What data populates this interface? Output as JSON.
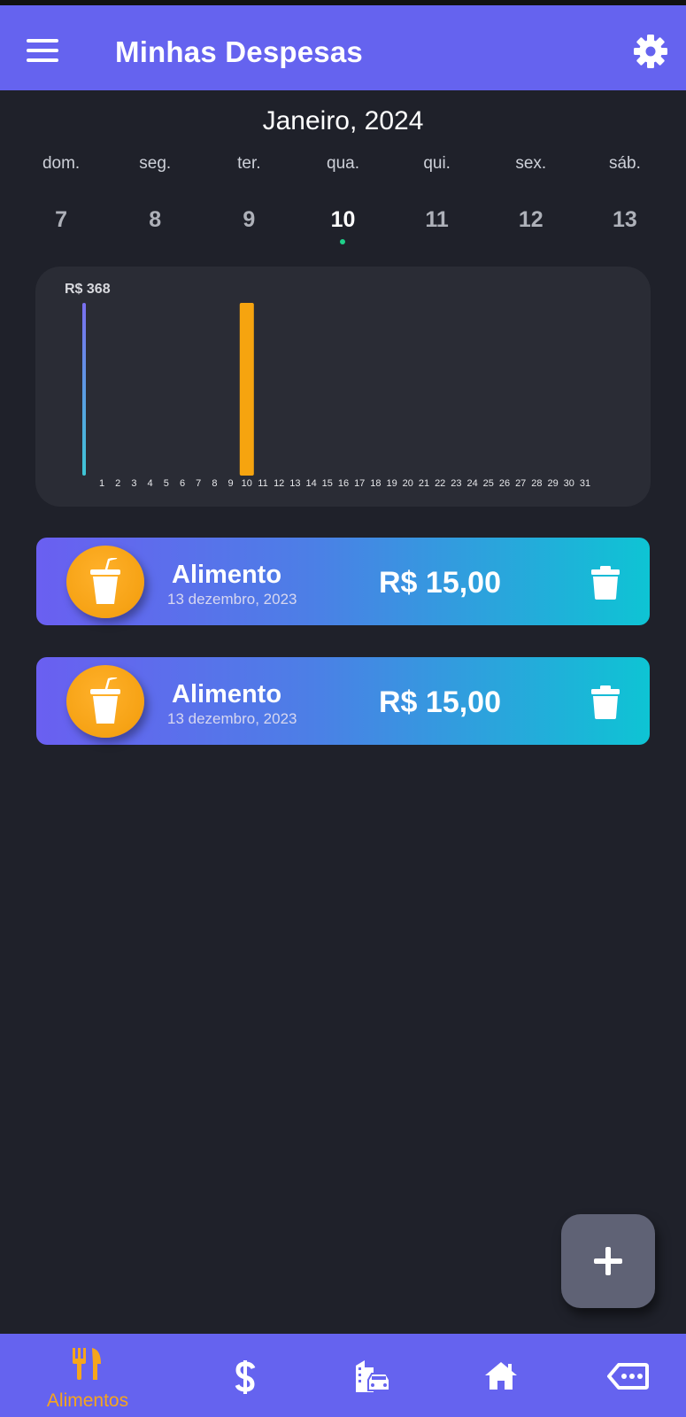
{
  "appbar": {
    "title": "Minhas Despesas"
  },
  "calendar": {
    "month_label": "Janeiro, 2024",
    "weekdays": [
      "dom.",
      "seg.",
      "ter.",
      "qua.",
      "qui.",
      "sex.",
      "sáb."
    ],
    "days": [
      "7",
      "8",
      "9",
      "10",
      "11",
      "12",
      "13"
    ],
    "selected_day": "10"
  },
  "chart_data": {
    "type": "bar",
    "y_max_label": "R$ 368",
    "categories": [
      "1",
      "2",
      "3",
      "4",
      "5",
      "6",
      "7",
      "8",
      "9",
      "10",
      "11",
      "12",
      "13",
      "14",
      "15",
      "16",
      "17",
      "18",
      "19",
      "20",
      "21",
      "22",
      "23",
      "24",
      "25",
      "26",
      "27",
      "28",
      "29",
      "30",
      "31"
    ],
    "values": [
      0,
      0,
      0,
      0,
      0,
      0,
      0,
      0,
      0,
      368,
      0,
      0,
      0,
      0,
      0,
      0,
      0,
      0,
      0,
      0,
      0,
      0,
      0,
      0,
      0,
      0,
      0,
      0,
      0,
      0,
      0
    ],
    "ylim": [
      0,
      368
    ],
    "highlight_color": "#f6a40f"
  },
  "expenses": [
    {
      "name": "Alimento",
      "date": "13 dezembro, 2023",
      "amount": "R$ 15,00"
    },
    {
      "name": "Alimento",
      "date": "13 dezembro, 2023",
      "amount": "R$ 15,00"
    }
  ],
  "bottom_nav": {
    "active_label": "Alimentos",
    "items": [
      "fork-knife-icon",
      "dollar-icon",
      "city-car-icon",
      "home-icon",
      "tag-icon"
    ]
  },
  "colors": {
    "primary": "#6563ef",
    "background": "#1f212a",
    "accent": "#f6a40f",
    "selected_dot": "#1fd08a"
  }
}
